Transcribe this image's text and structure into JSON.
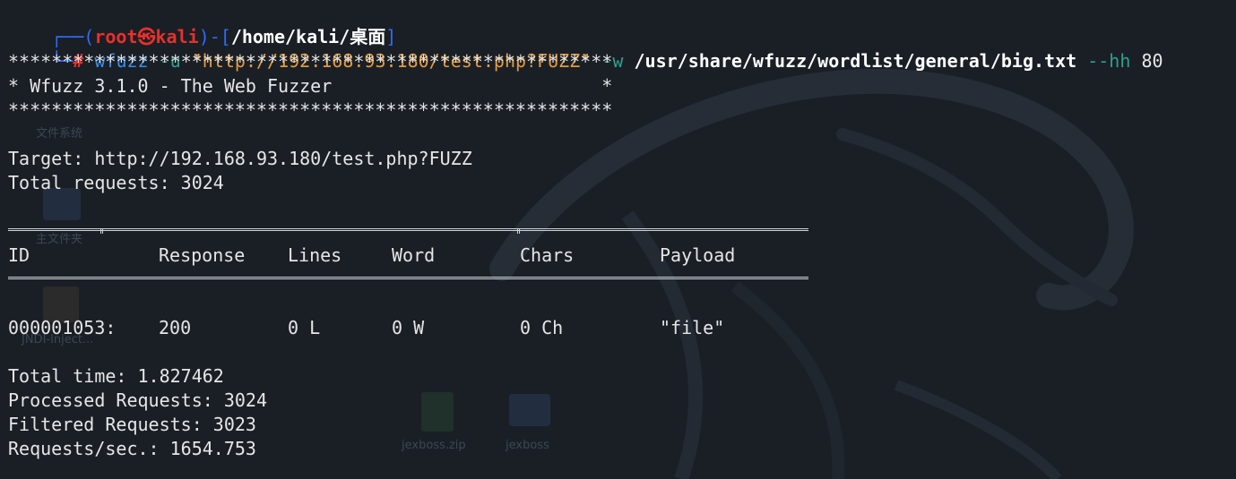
{
  "prompt": {
    "user": "root",
    "symbol": "㉿",
    "host": "kali",
    "cwd": "/home/kali/桌面"
  },
  "command": {
    "hash": "#",
    "program": "wfuzz",
    "opt_u": "-u",
    "url": "\"http://192.168.93.180/test.php?FUZZ\"",
    "opt_w": "-w",
    "wordlist": "/usr/share/wfuzz/wordlist/general/big.txt",
    "opt_hh": "--hh",
    "hh_value": "80"
  },
  "banner": {
    "stars": "********************************************************",
    "title": "* Wfuzz 3.1.0 - The Web Fuzzer                         *"
  },
  "summary": {
    "target": "Target: http://192.168.93.180/test.php?FUZZ",
    "total_requests": "Total requests: 3024"
  },
  "table": {
    "headers": [
      "ID",
      "Response",
      "Lines",
      "Word",
      "Chars",
      "Payload"
    ],
    "rows": [
      [
        "000001053:",
        "200",
        "0 L",
        "0 W",
        "0 Ch",
        "\"file\""
      ]
    ]
  },
  "footer": {
    "total_time": "Total time: 1.827462",
    "processed": "Processed Requests: 3024",
    "filtered": "Filtered Requests: 3023",
    "rate": "Requests/sec.: 1654.753"
  },
  "desktop": {
    "icons": [
      "文件系统",
      "主文件夹",
      "JNDI-Inject...",
      "jexboss.zip",
      "jexboss"
    ]
  }
}
